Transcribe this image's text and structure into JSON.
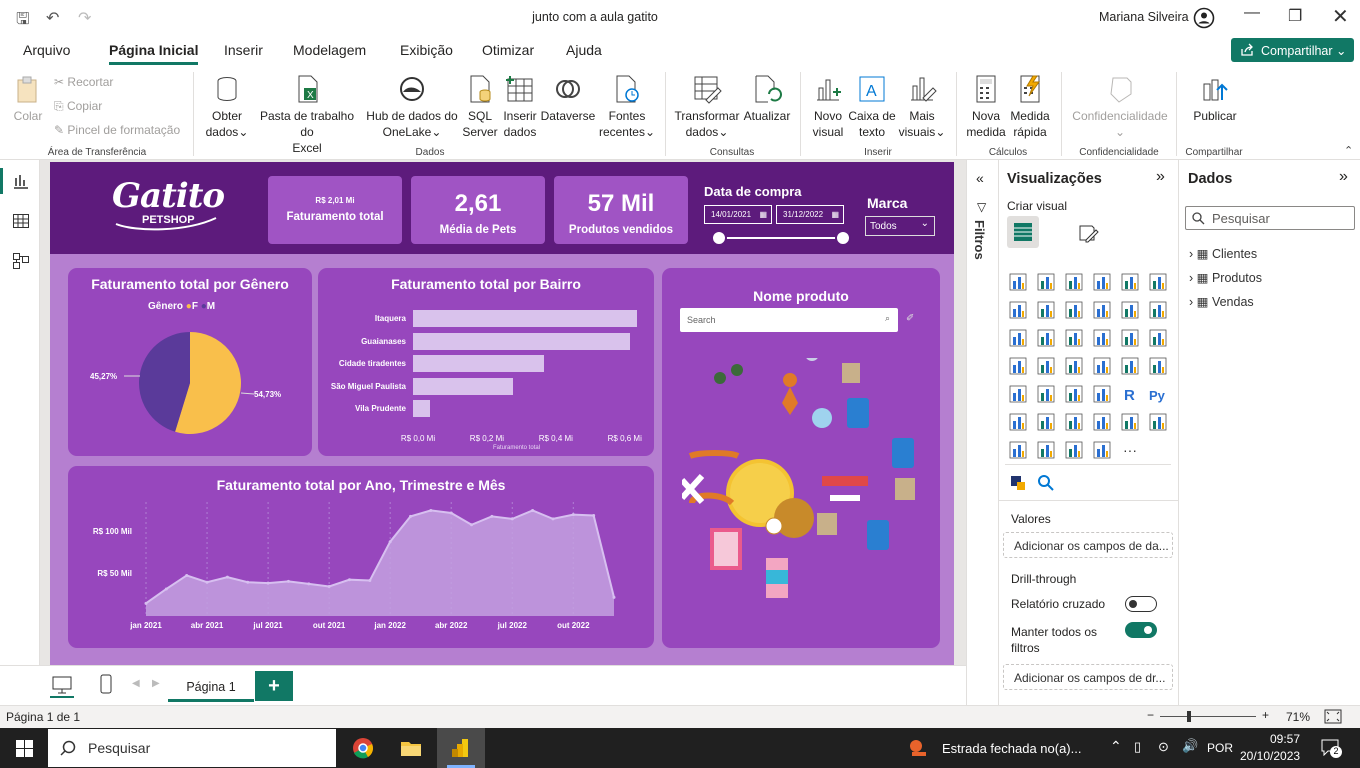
{
  "window": {
    "title": "junto com a aula gatito",
    "user": "Mariana Silveira"
  },
  "menu": [
    "Arquivo",
    "Página Inicial",
    "Inserir",
    "Modelagem",
    "Exibição",
    "Otimizar",
    "Ajuda"
  ],
  "share_label": "Compartilhar",
  "ribbon": {
    "colar": "Colar",
    "recortar": "Recortar",
    "copiar": "Copiar",
    "pincel": "Pincel de formatação",
    "obter1": "Obter",
    "obter2": "dados",
    "excel1": "Pasta de trabalho do",
    "excel2": "Excel",
    "hub1": "Hub de dados do",
    "hub2": "OneLake",
    "sql1": "SQL",
    "sql2": "Server",
    "inserir1": "Inserir",
    "inserir2": "dados",
    "dataverse": "Dataverse",
    "fontes1": "Fontes",
    "fontes2": "recentes",
    "transf1": "Transformar",
    "transf2": "dados",
    "atualizar": "Atualizar",
    "novo1": "Novo",
    "novo2": "visual",
    "caixa1": "Caixa de",
    "caixa2": "texto",
    "mais1": "Mais",
    "mais2": "visuais",
    "nova1": "Nova",
    "nova2": "medida",
    "rapida1": "Medida",
    "rapida2": "rápida",
    "confid": "Confidencialidade",
    "publicar": "Publicar",
    "groups": {
      "area": "Área de Transferência",
      "dados": "Dados",
      "consultas": "Consultas",
      "inserir": "Inserir",
      "calculos": "Cálculos",
      "confid": "Confidencialidade",
      "compartilhar": "Compartilhar"
    }
  },
  "dashboard": {
    "logo_main": "Gatito",
    "logo_sub": "PETSHOP",
    "kpis": [
      {
        "value": "R$ 2,01 Mi",
        "label": "Faturamento total"
      },
      {
        "value": "2,61",
        "label": "Média de Pets"
      },
      {
        "value": "57 Mil",
        "label": "Produtos vendidos"
      }
    ],
    "date_filter": {
      "title": "Data de compra",
      "start": "14/01/2021",
      "end": "31/12/2022"
    },
    "brand_filter": {
      "title": "Marca",
      "value": "Todos"
    },
    "product_search": {
      "title": "Nome produto",
      "placeholder": "Search"
    }
  },
  "chart_data": [
    {
      "type": "pie",
      "title": "Faturamento total por Gênero",
      "legend_title": "Gênero",
      "categories": [
        "F",
        "M"
      ],
      "values": [
        54.73,
        45.27
      ],
      "labels": [
        "54,73%",
        "45,27%"
      ],
      "colors": [
        "#f9bf4b",
        "#5a3a9a"
      ]
    },
    {
      "type": "bar",
      "orientation": "horizontal",
      "title": "Faturamento total por Bairro",
      "categories": [
        "Itaquera",
        "Guaianases",
        "Cidade tiradentes",
        "São Miguel Paulista",
        "Vila Prudente"
      ],
      "values": [
        0.65,
        0.63,
        0.38,
        0.29,
        0.05
      ],
      "xlabel": "Faturamento total",
      "xticks": [
        "R$ 0,0 Mi",
        "R$ 0,2 Mi",
        "R$ 0,4 Mi",
        "R$ 0,6 Mi"
      ],
      "xlim": [
        0,
        0.65
      ]
    },
    {
      "type": "area",
      "title": "Faturamento total por Ano, Trimestre e Mês",
      "x": [
        "jan 2021",
        "fev 2021",
        "mar 2021",
        "abr 2021",
        "mai 2021",
        "jun 2021",
        "jul 2021",
        "ago 2021",
        "set 2021",
        "out 2021",
        "nov 2021",
        "dez 2021",
        "jan 2022",
        "fev 2022",
        "mar 2022",
        "abr 2022",
        "mai 2022",
        "jun 2022",
        "jul 2022",
        "ago 2022",
        "set 2022",
        "out 2022",
        "nov 2022",
        "dez 2022"
      ],
      "values": [
        15,
        32,
        48,
        40,
        46,
        40,
        39,
        41,
        38,
        35,
        43,
        42,
        88,
        118,
        125,
        122,
        108,
        118,
        115,
        125,
        115,
        120,
        119,
        22
      ],
      "yticks": [
        "R$ 50 Mil",
        "R$ 100 Mil"
      ],
      "ytick_values": [
        50,
        100
      ],
      "xticks": [
        "jan 2021",
        "abr 2021",
        "jul 2021",
        "out 2021",
        "jan 2022",
        "abr 2022",
        "jul 2022",
        "out 2022"
      ],
      "ylim": [
        0,
        135
      ],
      "color": "#c3a1e0"
    }
  ],
  "filters_label": "Filtros",
  "viz_pane": {
    "title": "Visualizações",
    "subtitle": "Criar visual",
    "valores": "Valores",
    "valores_field": "Adicionar os campos de da...",
    "drill": "Drill-through",
    "cross": "Relatório cruzado",
    "keep1": "Manter todos os",
    "keep2": "filtros",
    "drill_field": "Adicionar os campos de dr..."
  },
  "data_pane": {
    "title": "Dados",
    "search_placeholder": "Pesquisar",
    "tables": [
      "Clientes",
      "Produtos",
      "Vendas"
    ]
  },
  "page_tab": "Página 1",
  "status": {
    "page": "Página 1 de 1",
    "zoom": "71%"
  },
  "taskbar": {
    "search": "Pesquisar",
    "weather": "Estrada fechada no(a)...",
    "lang": "POR",
    "time": "09:57",
    "date": "20/10/2023",
    "notif": "2"
  }
}
